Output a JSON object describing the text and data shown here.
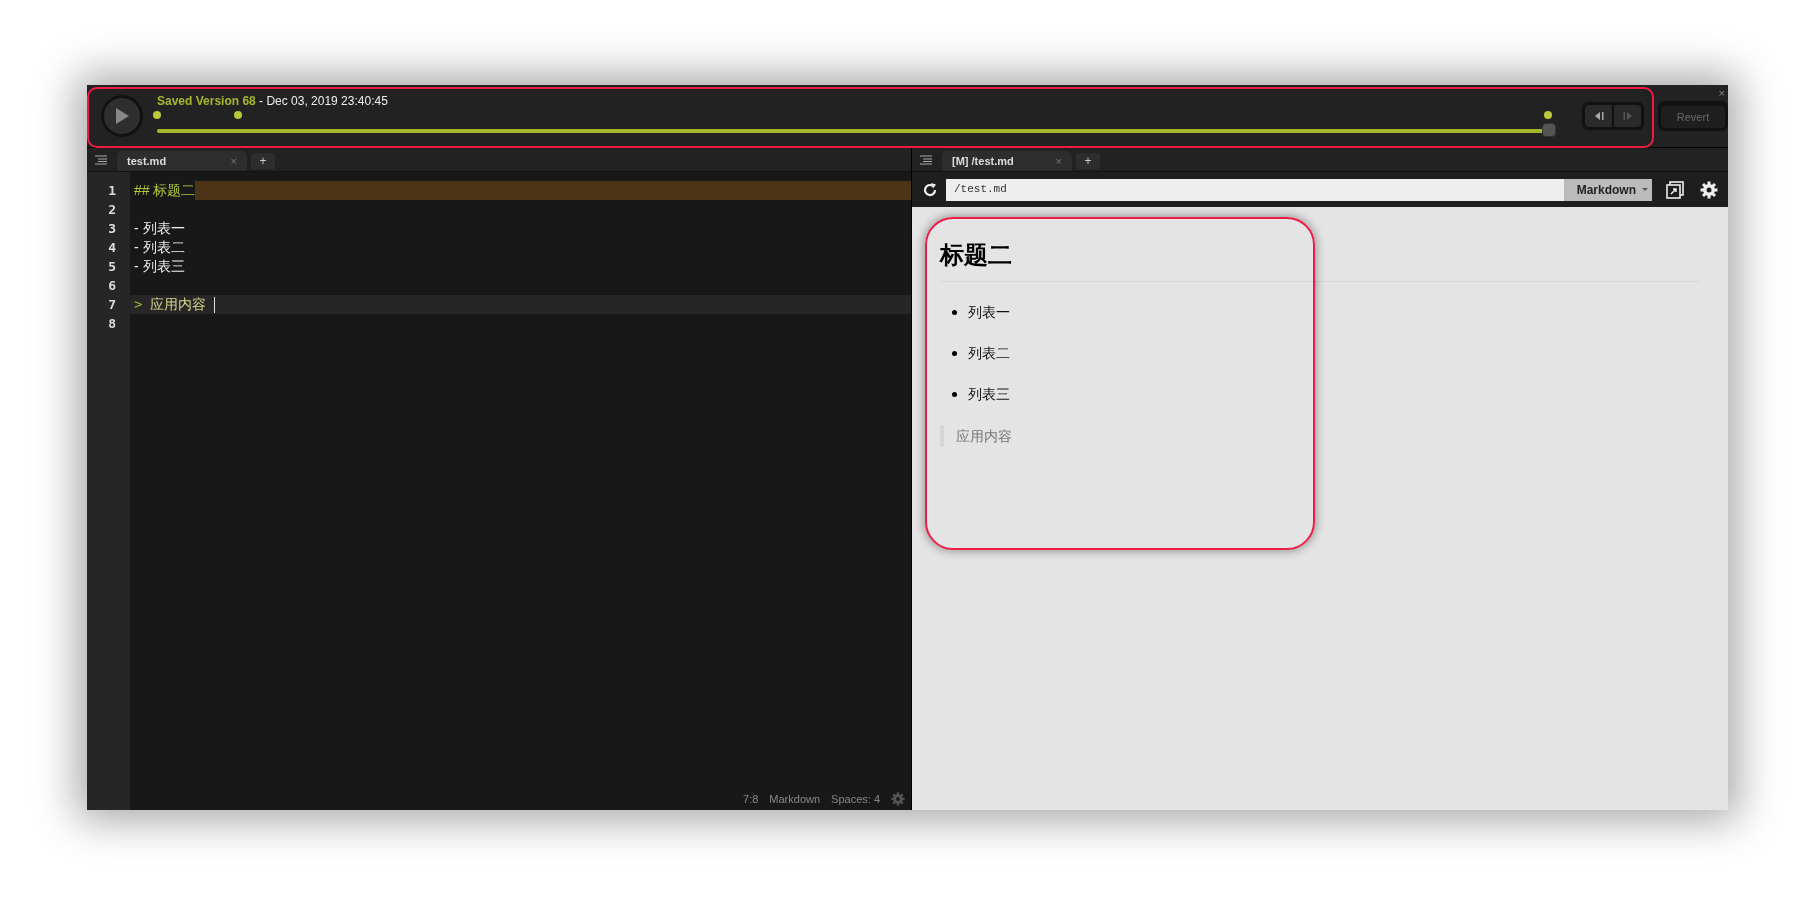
{
  "window": {
    "close": "×"
  },
  "history_bar": {
    "saved_label": "Saved Version 68",
    "date": " - Dec 03, 2019 23:40:45",
    "timeline": {
      "level": 1
    },
    "revert_button": {
      "label": "Revert",
      "disabled": true
    }
  },
  "editor": {
    "tab": {
      "label": "test.md",
      "close": "×"
    },
    "add_tab": "+",
    "lines": [
      {
        "number": "1",
        "kind": "heading",
        "marker": "##",
        "text": "标题二",
        "active": false,
        "highlighted": true
      },
      {
        "number": "2",
        "kind": "empty",
        "active": false,
        "highlighted": false
      },
      {
        "number": "3",
        "kind": "list",
        "marker": "-",
        "text": "列表一",
        "active": false,
        "highlighted": false
      },
      {
        "number": "4",
        "kind": "list",
        "marker": "-",
        "text": "列表二",
        "active": false,
        "highlighted": false
      },
      {
        "number": "5",
        "kind": "list",
        "marker": "-",
        "text": "列表三",
        "active": false,
        "highlighted": false
      },
      {
        "number": "6",
        "kind": "empty",
        "active": false,
        "highlighted": false
      },
      {
        "number": "7",
        "kind": "quote",
        "marker": ">",
        "text": "应用内容",
        "active": true,
        "highlighted": false
      },
      {
        "number": "8",
        "kind": "empty",
        "active": false,
        "highlighted": false
      }
    ],
    "status_bar": [
      "7:8",
      "Markdown",
      "Spaces: 4"
    ]
  },
  "preview": {
    "tab": {
      "label": "[M] /test.md",
      "close": "×"
    },
    "add_tab": "+",
    "url": "/test.md",
    "mode": "Markdown",
    "blocks": [
      {
        "kind": "heading",
        "text": "标题二"
      },
      {
        "kind": "list",
        "items": [
          "列表一",
          "列表二",
          "列表三"
        ]
      },
      {
        "kind": "quote",
        "text": "应用内容"
      }
    ]
  }
}
